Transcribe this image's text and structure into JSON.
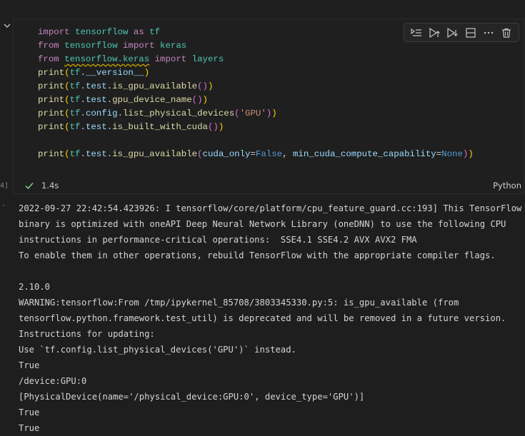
{
  "cell": {
    "code_lines": [
      "import tensorflow as tf",
      "from tensorflow import keras",
      "from tensorflow.keras import layers",
      "print(tf.__version__)",
      "print(tf.test.is_gpu_available())",
      "print(tf.test.gpu_device_name())",
      "print(tf.config.list_physical_devices('GPU'))",
      "print(tf.test.is_built_with_cuda())",
      "",
      "print(tf.test.is_gpu_available(cuda_only=False, min_cuda_compute_capability=None))"
    ],
    "exec_count": "4]",
    "duration": "1.4s",
    "language": "Python",
    "toolbar_icons": [
      "run-by-line-icon",
      "execute-above-icon",
      "execute-below-icon",
      "split-cell-icon",
      "more-actions-icon",
      "delete-icon"
    ]
  },
  "output": {
    "prompt": "·",
    "lines": [
      "2022-09-27 22:42:54.423926: I tensorflow/core/platform/cpu_feature_guard.cc:193] This TensorFlow",
      "binary is optimized with oneAPI Deep Neural Network Library (oneDNN) to use the following CPU",
      "instructions in performance-critical operations:  SSE4.1 SSE4.2 AVX AVX2 FMA",
      "To enable them in other operations, rebuild TensorFlow with the appropriate compiler flags.",
      "",
      "2.10.0",
      "WARNING:tensorflow:From /tmp/ipykernel_85708/3803345330.py:5: is_gpu_available (from",
      "tensorflow.python.framework.test_util) is deprecated and will be removed in a future version.",
      "Instructions for updating:",
      "Use `tf.config.list_physical_devices('GPU')` instead.",
      "True",
      "/device:GPU:0",
      "[PhysicalDevice(name='/physical_device:GPU:0', device_type='GPU')]",
      "True",
      "True"
    ]
  }
}
